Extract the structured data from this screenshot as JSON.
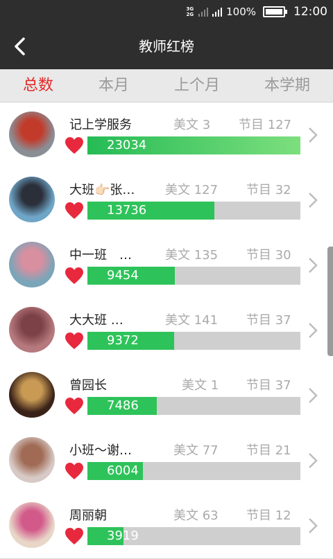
{
  "status_bar": {
    "network_top": "3G",
    "network_bottom": "2G",
    "battery": "100%",
    "time": "12:00"
  },
  "header": {
    "title": "教师红榜"
  },
  "tabs": [
    {
      "label": "总数",
      "active": true
    },
    {
      "label": "本月",
      "active": false
    },
    {
      "label": "上个月",
      "active": false
    },
    {
      "label": "本学期",
      "active": false
    }
  ],
  "ranking": [
    {
      "name": "记上学服务",
      "articles": "美文 3",
      "programs": "节目 127",
      "score": "23034",
      "progress": 1.0,
      "avatar_colors": [
        "#8a8f96",
        "#c23a2a"
      ]
    },
    {
      "name": "大班👉🏻张…",
      "articles": "美文 127",
      "programs": "节目 32",
      "score": "13736",
      "progress": 0.596,
      "avatar_colors": [
        "#6fa6c8",
        "#2b2f3a"
      ]
    },
    {
      "name": "中一班　…",
      "articles": "美文 135",
      "programs": "节目 30",
      "score": "9454",
      "progress": 0.41,
      "avatar_colors": [
        "#7ba5b8",
        "#d88fa0"
      ]
    },
    {
      "name": "大大班 …",
      "articles": "美文 141",
      "programs": "节目 37",
      "score": "9372",
      "progress": 0.407,
      "avatar_colors": [
        "#b67a7e",
        "#7c4146"
      ]
    },
    {
      "name": "曾园长",
      "articles": "美文 1",
      "programs": "节目 37",
      "score": "7486",
      "progress": 0.325,
      "avatar_colors": [
        "#3a2218",
        "#c89a54"
      ]
    },
    {
      "name": "小班～谢…",
      "articles": "美文 77",
      "programs": "节目 21",
      "score": "6004",
      "progress": 0.26,
      "avatar_colors": [
        "#d7c9c5",
        "#a06a54"
      ]
    },
    {
      "name": "周丽朝",
      "articles": "美文 63",
      "programs": "节目 12",
      "score": "3919",
      "progress": 0.17,
      "avatar_colors": [
        "#e8d7c8",
        "#d25a8a"
      ]
    }
  ],
  "theme": {
    "header_bg": "#2e2e2e",
    "active_tab": "#e22929",
    "bar_fill": "#2ec35a",
    "bar_track": "#cfcfcf",
    "heart": "#e8283c"
  },
  "icons": {
    "back": "chevron-left-icon",
    "row_arrow": "chevron-right-icon",
    "like": "heart-icon"
  }
}
